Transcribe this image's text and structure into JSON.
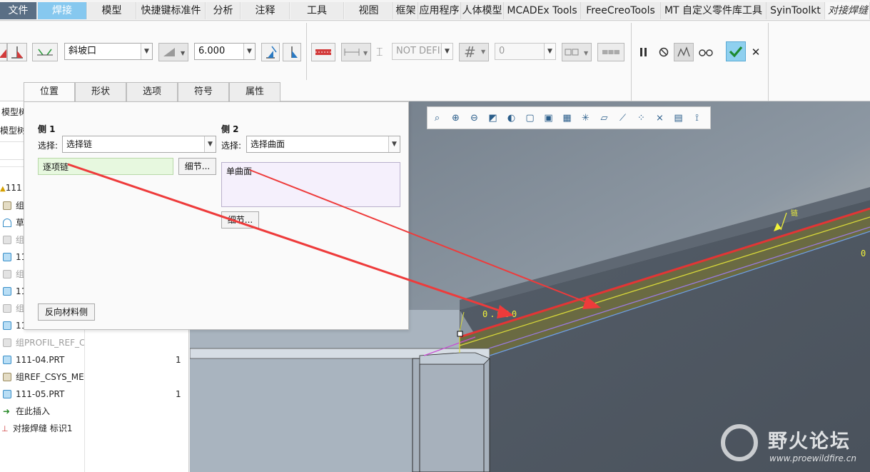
{
  "menu": {
    "tabs": [
      "文件",
      "焊接",
      "模型",
      "快捷键标准件",
      "分析",
      "注释",
      "工具",
      "视图",
      "框架",
      "应用程序",
      "人体模型",
      "MCADEx Tools",
      "FreeCreoTools",
      "MT 自定义零件库工具",
      "SyinToolkt",
      "对接焊缝"
    ]
  },
  "ribbon": {
    "edge_prep": "斜坡口",
    "size_value": "6.000",
    "not_defined": "NOT DEFIN",
    "hash_symbol": "#",
    "count_value": "0",
    "cancel_symbol": "✕"
  },
  "panel": {
    "tabs": [
      "位置",
      "形状",
      "选项",
      "符号",
      "属性"
    ],
    "side1": {
      "title": "侧 1",
      "select_label": "选择:",
      "select_value": "选择链",
      "collector_value": "逐项链",
      "details_button": "细节..."
    },
    "side2": {
      "title": "侧 2",
      "select_label": "选择:",
      "select_value": "选择曲面",
      "collector_value": "单曲面",
      "details_button": "细节..."
    },
    "flip_button": "反向材料侧"
  },
  "model_tree": {
    "header1": "模型树",
    "header2": "模型树",
    "rows": [
      {
        "label": "111",
        "icon": "warning-icon",
        "grey": false
      },
      {
        "label": "组",
        "icon": "group-icon",
        "grey": false
      },
      {
        "label": "草",
        "icon": "sketch-icon",
        "grey": false
      },
      {
        "label": "组",
        "icon": "group-icon",
        "grey": true
      },
      {
        "label": "11",
        "icon": "part-icon",
        "grey": false
      },
      {
        "label": "组",
        "icon": "group-icon",
        "grey": true
      },
      {
        "label": "11",
        "icon": "part-icon",
        "grey": false
      },
      {
        "label": "组",
        "icon": "group-icon",
        "grey": true
      },
      {
        "label": "11",
        "icon": "part-icon",
        "grey": false
      },
      {
        "label": "组PROFIL_REF_C",
        "icon": "group-icon",
        "grey": true
      },
      {
        "label": "111-04.PRT",
        "icon": "part-icon",
        "grey": false,
        "count": "1"
      },
      {
        "label": "组REF_CSYS_ME",
        "icon": "group-icon",
        "grey": false
      },
      {
        "label": "111-05.PRT",
        "icon": "part-icon",
        "grey": false,
        "count": "1"
      },
      {
        "label": "在此插入",
        "icon": "insert-arrow-icon",
        "grey": false
      },
      {
        "label": "对接焊缝 标识1",
        "icon": "butt-weld-icon",
        "grey": false
      }
    ]
  },
  "viewport": {
    "annotations": [
      "链",
      "0.000",
      "0"
    ]
  },
  "view_toolbar": {
    "icons": [
      "refit-icon",
      "zoom-in-icon",
      "zoom-out-icon",
      "repaint-icon",
      "display-style-icon",
      "saved-views-icon",
      "view-manager-icon",
      "perspective-icon",
      "datum-display-icon",
      "plane-display-icon",
      "axis-display-icon",
      "point-display-icon",
      "csys-display-icon",
      "annotation-display-icon",
      "spin-center-icon"
    ]
  },
  "watermark": {
    "title": "野火论坛",
    "url": "www.proewildfire.cn"
  },
  "colors": {
    "active_tab": "#86c8ef",
    "file_tab": "#5a6f85",
    "ok_button": "#8fd0ef",
    "weld_highlight": "#e33535",
    "annotation_yellow": "#f2f23a",
    "collector_side1": "#e7f8df",
    "collector_side2": "#f5f0fc"
  }
}
